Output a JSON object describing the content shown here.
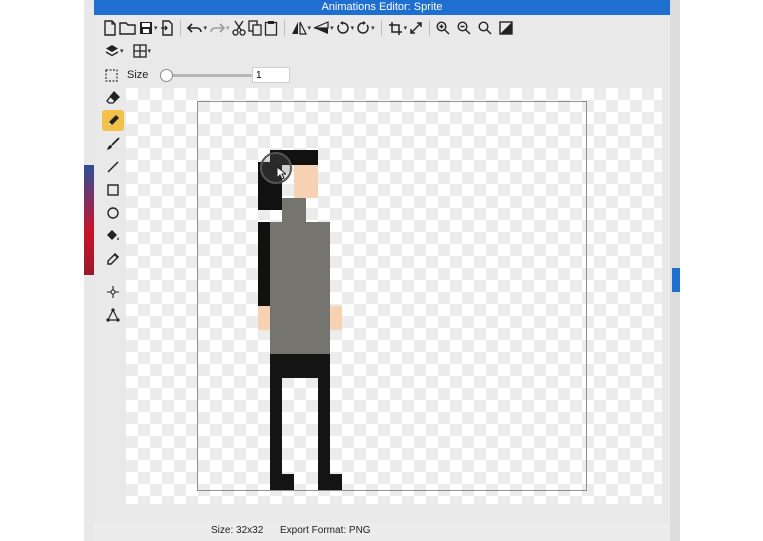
{
  "window": {
    "title": "Animations Editor: Sprite"
  },
  "toolbar": {
    "row1": [
      "new-icon",
      "open-icon",
      "save-icon",
      "export-icon",
      "undo-icon",
      "redo-icon",
      "cut-icon",
      "copy-icon",
      "paste-icon",
      "flip-horizontal-icon",
      "flip-vertical-icon",
      "rotate-left-icon",
      "rotate-right-icon",
      "crop-icon",
      "resize-icon",
      "zoom-in-icon",
      "zoom-out-icon",
      "zoom-fit-icon",
      "contrast-icon"
    ],
    "row2": [
      "layers-icon",
      "grid-icon"
    ]
  },
  "options": {
    "size_label": "Size",
    "size_value": "1",
    "size_slider_fraction": 0.0
  },
  "tools": [
    {
      "name": "eraser-icon",
      "active": false
    },
    {
      "name": "pencil-icon",
      "active": true
    },
    {
      "name": "brush-icon",
      "active": false
    },
    {
      "name": "line-icon",
      "active": false
    },
    {
      "name": "rectangle-icon",
      "active": false
    },
    {
      "name": "ellipse-icon",
      "active": false
    },
    {
      "name": "fill-bucket-icon",
      "active": false
    },
    {
      "name": "eyedropper-icon",
      "active": false
    },
    {
      "name": "move-icon",
      "active": false
    },
    {
      "name": "transform-icon",
      "active": false
    }
  ],
  "colors": {
    "title_bar": "#1f6fd0",
    "active_tool": "#f1c14a",
    "hair": "#111111",
    "skin": "#f6d2b2",
    "shirt": "#76746f",
    "pants": "#141414"
  },
  "status": {
    "size_text": "Size: 32x32",
    "format_text": "Export Format: PNG"
  }
}
